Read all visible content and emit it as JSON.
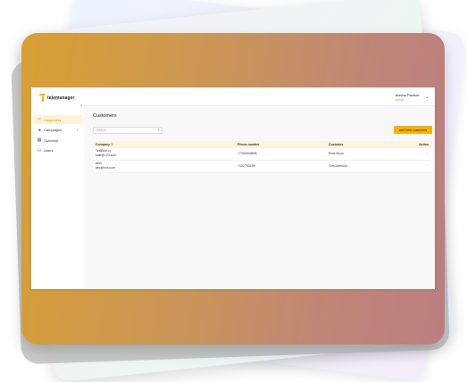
{
  "app": {
    "logo_text": "telemanager",
    "logo_sub": "by ASA"
  },
  "sidebar": {
    "items": [
      {
        "label": "Customers",
        "icon": "customers-icon"
      },
      {
        "label": "Campaigns",
        "icon": "campaigns-icon"
      },
      {
        "label": "Outcome",
        "icon": "outcome-icon"
      },
      {
        "label": "Users",
        "icon": "users-icon"
      }
    ]
  },
  "header": {
    "user_name": "Anisha Paulsin",
    "user_role": "Admin"
  },
  "main": {
    "title": "Customers",
    "search_placeholder": "Search",
    "add_button": "Add New customers",
    "columns": [
      "Company",
      "Phone number",
      "Customer",
      "Action"
    ],
    "rows": [
      {
        "company": "TestBob co",
        "email": "sale@123.com",
        "phone": "+7200034898",
        "customer": "Elvis Moon",
        "action": "···"
      },
      {
        "company": "ABC",
        "email": "abc@xxx.com",
        "phone": "+102700189",
        "customer": "Tom Johnson",
        "action": "···"
      }
    ]
  },
  "colors": {
    "accent": "#f4b400",
    "frame_start": "#d8a032",
    "frame_end": "#bb7e80"
  }
}
